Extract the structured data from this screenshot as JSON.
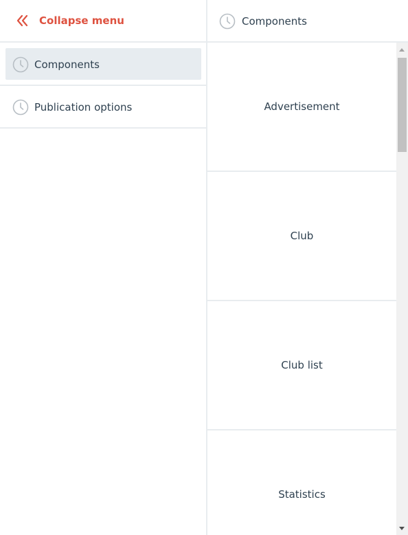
{
  "sidebar": {
    "collapse_label": "Collapse menu",
    "collapse_icon": "double-chevron-left-icon",
    "items": [
      {
        "label": "Components",
        "icon": "clock-icon",
        "active": true
      },
      {
        "label": "Publication options",
        "icon": "clock-icon",
        "active": false
      }
    ]
  },
  "content": {
    "header_label": "Components",
    "header_icon": "clock-icon",
    "tiles": [
      {
        "label": "Advertisement"
      },
      {
        "label": "Club"
      },
      {
        "label": "Club list"
      },
      {
        "label": "Statistics"
      }
    ]
  },
  "colors": {
    "accent": "#de5240",
    "text": "#2f4150",
    "active_bg": "#e7ecf0",
    "icon": "#b7bec4",
    "divider": "#e8ecef"
  }
}
